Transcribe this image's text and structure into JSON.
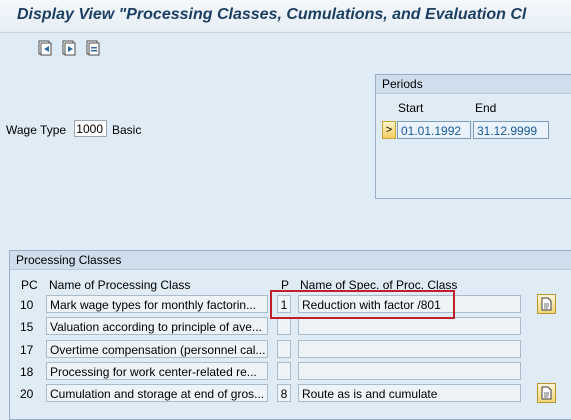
{
  "window": {
    "title": "Display View \"Processing Classes, Cumulations, and Evaluation Cl"
  },
  "toolbar": {
    "buttons": [
      "previous-entry-icon",
      "next-entry-icon",
      "other-entry-icon"
    ]
  },
  "wage_type": {
    "label": "Wage Type",
    "value": "1000",
    "text": "Basic"
  },
  "periods": {
    "title": "Periods",
    "start_label": "Start",
    "end_label": "End",
    "start_value": "01.01.1992",
    "end_value": "31.12.9999",
    "select_glyph": ">"
  },
  "processing_classes": {
    "title": "Processing Classes",
    "headers": {
      "pc": "PC",
      "name": "Name of Processing Class",
      "p": "P",
      "spec": "Name of Spec. of Proc. Class"
    },
    "rows": [
      {
        "pc": "10",
        "name": "Mark wage types for monthly factorin...",
        "p": "1",
        "spec": "Reduction with factor /801"
      },
      {
        "pc": "15",
        "name": "Valuation according to principle of ave...",
        "p": "",
        "spec": ""
      },
      {
        "pc": "17",
        "name": "Overtime compensation (personnel cal...",
        "p": "",
        "spec": ""
      },
      {
        "pc": "18",
        "name": "Processing for work center-related re...",
        "p": "",
        "spec": ""
      },
      {
        "pc": "20",
        "name": "Cumulation and storage at end of gros...",
        "p": "8",
        "spec": "Route as is and cumulate"
      }
    ]
  },
  "colors": {
    "background": "#dfebf5",
    "title": "#1c3f63",
    "highlight": "#c0202a"
  }
}
